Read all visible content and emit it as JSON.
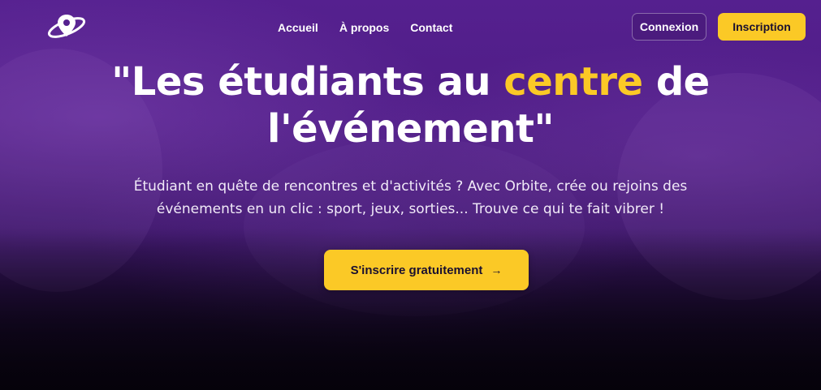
{
  "nav": {
    "logo_icon": "planet-pin-icon",
    "links": [
      {
        "label": "Accueil"
      },
      {
        "label": "À propos"
      },
      {
        "label": "Contact"
      }
    ],
    "login_label": "Connexion",
    "signup_label": "Inscription"
  },
  "hero": {
    "headline_before": "\"Les étudiants au ",
    "headline_accent": "centre",
    "headline_after": " de l'événement\"",
    "subtitle": "Étudiant en quête de rencontres et d'activités ? Avec Orbite, crée ou rejoins des événements en un clic : sport, jeux, sorties... Trouve ce qui te fait vibrer !",
    "cta_label": "S'inscrire gratuitement",
    "cta_icon": "arrow-right-icon"
  },
  "colors": {
    "accent": "#fbc926",
    "background": "#55208f",
    "text": "#ffffff"
  }
}
